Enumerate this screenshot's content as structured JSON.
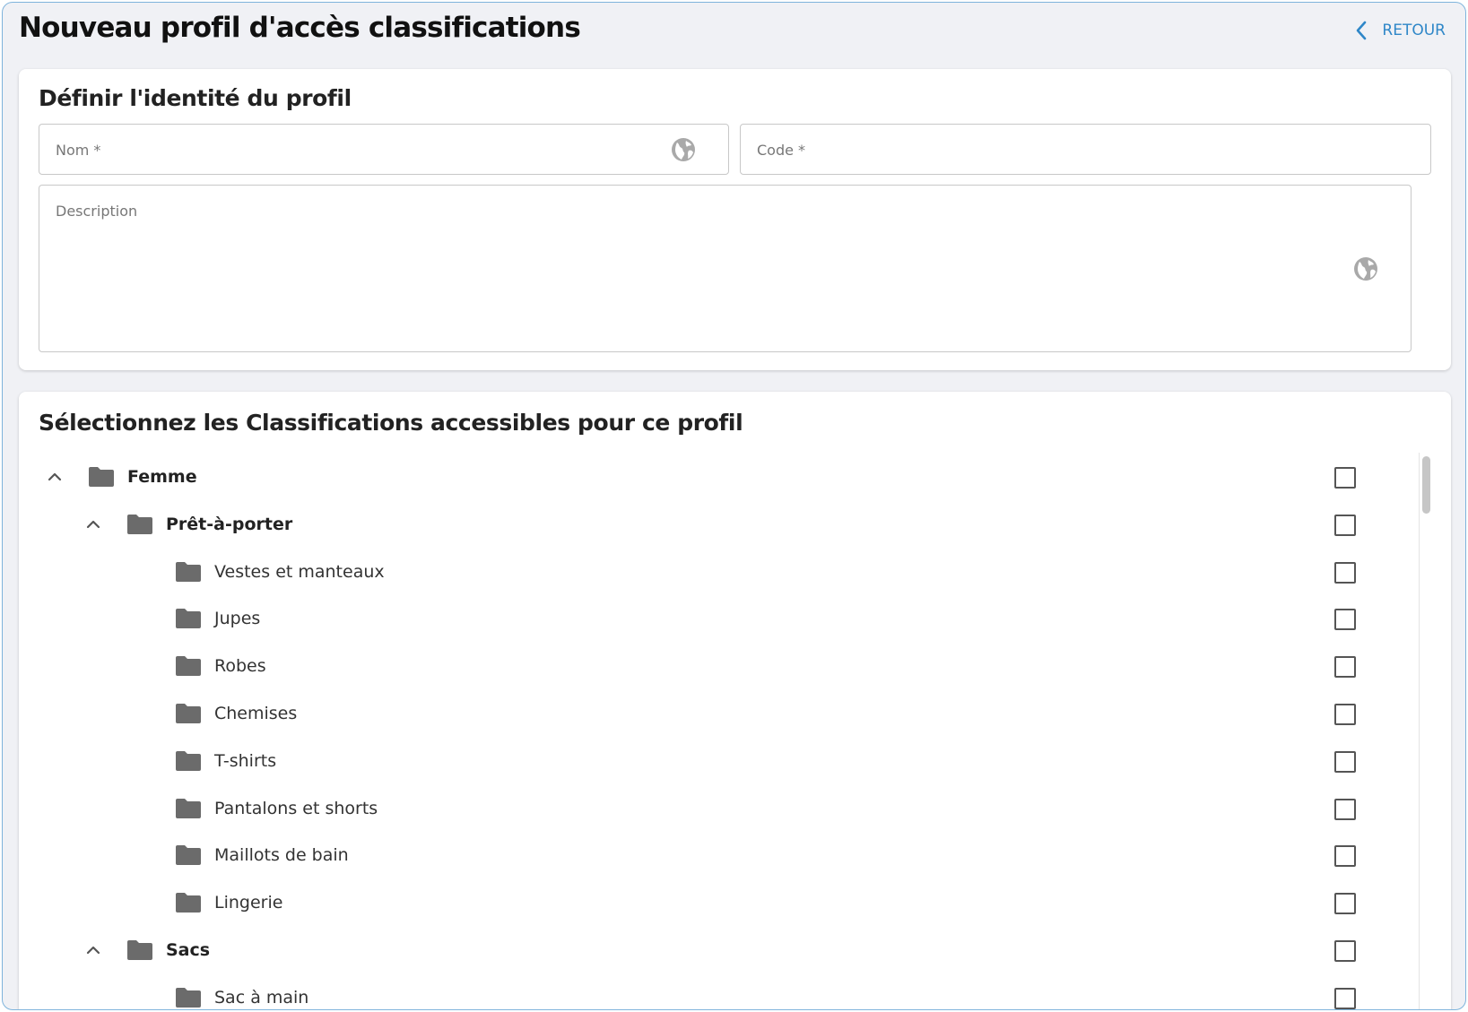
{
  "header": {
    "title": "Nouveau profil d'accès classifications",
    "back_label": "RETOUR"
  },
  "identity": {
    "title": "Définir l'identité du profil",
    "nom_label": "Nom *",
    "code_label": "Code *",
    "description_label": "Description"
  },
  "classifications": {
    "title": "Sélectionnez les Classifications accessibles pour ce profil",
    "nodes": [
      {
        "label": "Femme",
        "level": 0,
        "expandable": true,
        "expanded": true,
        "checked": false
      },
      {
        "label": "Prêt-à-porter",
        "level": 1,
        "expandable": true,
        "expanded": true,
        "checked": false
      },
      {
        "label": "Vestes et manteaux",
        "level": 2,
        "expandable": false,
        "checked": false
      },
      {
        "label": "Jupes",
        "level": 2,
        "expandable": false,
        "checked": false
      },
      {
        "label": "Robes",
        "level": 2,
        "expandable": false,
        "checked": false
      },
      {
        "label": "Chemises",
        "level": 2,
        "expandable": false,
        "checked": false
      },
      {
        "label": "T-shirts",
        "level": 2,
        "expandable": false,
        "checked": false
      },
      {
        "label": "Pantalons et shorts",
        "level": 2,
        "expandable": false,
        "checked": false
      },
      {
        "label": "Maillots de bain",
        "level": 2,
        "expandable": false,
        "checked": false
      },
      {
        "label": "Lingerie",
        "level": 2,
        "expandable": false,
        "checked": false
      },
      {
        "label": "Sacs",
        "level": 1,
        "expandable": true,
        "expanded": true,
        "checked": false
      },
      {
        "label": "Sac à main",
        "level": 2,
        "expandable": false,
        "checked": false
      }
    ]
  },
  "colors": {
    "accent": "#2f87c8",
    "background": "#f0f1f5",
    "folder": "#6b6b6b"
  },
  "icons": {
    "back": "chevron-left-icon",
    "translate": "globe-icon",
    "collapse": "chevron-up-icon",
    "folder": "folder-icon"
  }
}
